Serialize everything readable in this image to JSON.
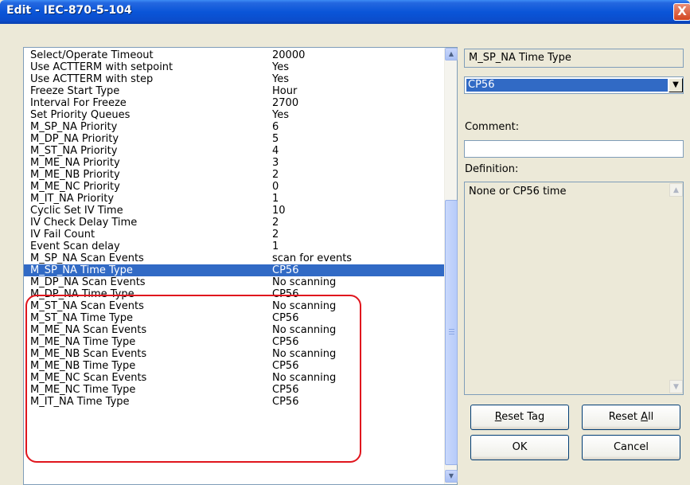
{
  "window": {
    "title": "Edit - IEC-870-5-104",
    "close_label": "X"
  },
  "list": {
    "rows": [
      {
        "name": "Select/Operate Timeout",
        "value": "20000"
      },
      {
        "name": "Use ACTTERM with setpoint",
        "value": "Yes"
      },
      {
        "name": "Use ACTTERM with step",
        "value": "Yes"
      },
      {
        "name": "Freeze Start Type",
        "value": "Hour"
      },
      {
        "name": "Interval For Freeze",
        "value": "2700"
      },
      {
        "name": "Set Priority Queues",
        "value": "Yes"
      },
      {
        "name": "M_SP_NA Priority",
        "value": "6"
      },
      {
        "name": "M_DP_NA Priority",
        "value": "5"
      },
      {
        "name": "M_ST_NA Priority",
        "value": "4"
      },
      {
        "name": "M_ME_NA Priority",
        "value": "3"
      },
      {
        "name": "M_ME_NB Priority",
        "value": "2"
      },
      {
        "name": "M_ME_NC Priority",
        "value": "0"
      },
      {
        "name": "M_IT_NA Priority",
        "value": "1"
      },
      {
        "name": "Cyclic Set IV Time",
        "value": "10"
      },
      {
        "name": "IV Check Delay Time",
        "value": "2"
      },
      {
        "name": "IV Fail Count",
        "value": "2"
      },
      {
        "name": "Event Scan delay",
        "value": "1"
      },
      {
        "name": "M_SP_NA Scan Events",
        "value": "scan for events"
      },
      {
        "name": "M_SP_NA Time Type",
        "value": "CP56",
        "selected": true
      },
      {
        "name": "M_DP_NA Scan Events",
        "value": "No scanning"
      },
      {
        "name": "M_DP_NA Time Type",
        "value": "CP56"
      },
      {
        "name": "M_ST_NA Scan Events",
        "value": "No scanning"
      },
      {
        "name": "M_ST_NA Time Type",
        "value": "CP56"
      },
      {
        "name": "M_ME_NA Scan Events",
        "value": "No scanning"
      },
      {
        "name": "M_ME_NA Time Type",
        "value": "CP56"
      },
      {
        "name": "M_ME_NB Scan Events",
        "value": "No scanning"
      },
      {
        "name": "M_ME_NB Time Type",
        "value": "CP56"
      },
      {
        "name": "M_ME_NC Scan Events",
        "value": "No scanning"
      },
      {
        "name": "M_ME_NC Time Type",
        "value": "CP56"
      },
      {
        "name": "M_IT_NA Time Type",
        "value": "CP56"
      }
    ]
  },
  "panel": {
    "tag_name": "M_SP_NA Time Type",
    "selected_value": "CP56",
    "comment_label": "Comment:",
    "comment_value": "",
    "definition_label": "Definition:",
    "definition_text": "None or CP56 time"
  },
  "buttons": {
    "reset_tag": {
      "mnemonic": "R",
      "rest": "eset Tag"
    },
    "reset_all": {
      "before": "Reset ",
      "mnemonic": "A",
      "after": "ll"
    },
    "ok": "OK",
    "cancel": "Cancel"
  },
  "colors": {
    "selection": "#316ac5",
    "highlight_outline": "#e0151d",
    "title_bar": "#0a55d8"
  },
  "icons": {
    "close": "close-icon",
    "combo_arrow": "triangle-down-icon",
    "scroll_up": "triangle-up-icon",
    "scroll_down": "triangle-down-icon"
  }
}
